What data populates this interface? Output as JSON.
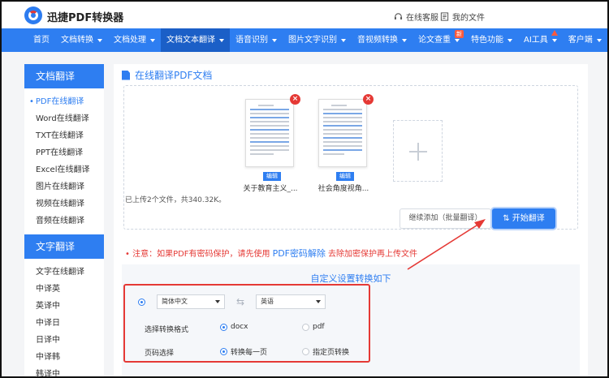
{
  "header": {
    "brand": "迅捷PDF转换器",
    "service": "在线客服",
    "files": "我的文件"
  },
  "nav": {
    "items": [
      {
        "label": "首页",
        "caret": false
      },
      {
        "label": "文档转换",
        "caret": true
      },
      {
        "label": "文档处理",
        "caret": true
      },
      {
        "label": "文档文本翻译",
        "caret": true,
        "active": true
      },
      {
        "label": "语音识别",
        "caret": true
      },
      {
        "label": "图片文字识别",
        "caret": true
      },
      {
        "label": "音视频转换",
        "caret": true
      },
      {
        "label": "论文查重",
        "caret": true,
        "badge": "新"
      },
      {
        "label": "特色功能",
        "caret": true
      },
      {
        "label": "AI工具",
        "caret": true,
        "dot": true
      },
      {
        "label": "客户端",
        "caret": true
      }
    ]
  },
  "sidebar": {
    "section1": "文档翻译",
    "section1_items": [
      "PDF在线翻译",
      "Word在线翻译",
      "TXT在线翻译",
      "PPT在线翻译",
      "Excel在线翻译",
      "图片在线翻译",
      "视频在线翻译",
      "音频在线翻译"
    ],
    "section2": "文字翻译",
    "section2_items": [
      "文字在线翻译",
      "中译英",
      "英译中",
      "中译日",
      "日译中",
      "中译韩",
      "韩译中"
    ]
  },
  "main": {
    "title": "在线翻译PDF文档",
    "files": [
      {
        "name": "关于教育主义_...",
        "edit": "编辑"
      },
      {
        "name": "社会角度视角...",
        "edit": "编辑"
      }
    ],
    "upload_status": "已上传2个文件，共340.32K。",
    "add_button": "继续添加（批量翻译）",
    "start_button": "开始翻译",
    "notice_prefix": "• 注意：如果PDF有密码保护，请先使用",
    "notice_link": "PDF密码解除",
    "notice_suffix": "去除加密保护再上传文件"
  },
  "settings": {
    "title": "自定义设置转换如下",
    "source_lang": "简体中文",
    "target_lang": "英语",
    "format_label": "选择转换格式",
    "format_options": [
      "docx",
      "pdf"
    ],
    "page_label": "页码选择",
    "page_options": [
      "转换每一页",
      "指定页转换"
    ]
  },
  "colors": {
    "primary": "#2e7ef1",
    "nav_active": "#1b5fc7",
    "danger": "#e53935"
  }
}
